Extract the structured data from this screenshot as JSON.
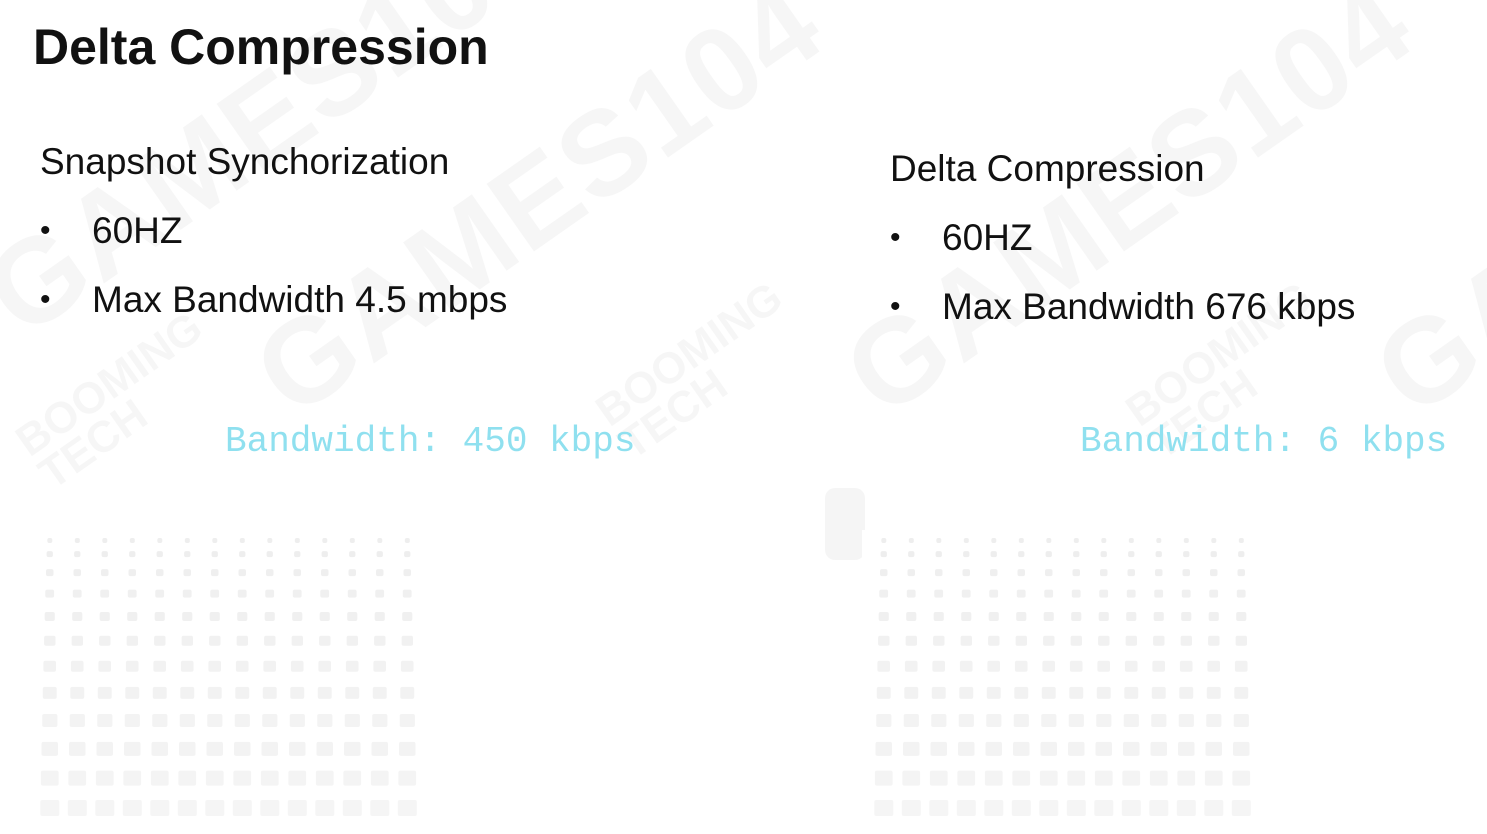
{
  "slide": {
    "title": "Delta Compression",
    "left_panel": {
      "heading": "Snapshot Synchorization",
      "bullets": [
        "60HZ",
        "Max Bandwidth 4.5 mbps"
      ],
      "bandwidth_readout": "Bandwidth: 450 kbps"
    },
    "right_panel": {
      "heading": "Delta Compression",
      "bullets": [
        "60HZ",
        "Max Bandwidth 676 kbps"
      ],
      "bandwidth_readout": "Bandwidth: 6 kbps"
    },
    "bullet_glyph": "•",
    "watermark": {
      "big_text": "GAMES104",
      "small_text_line1": "BOOMING",
      "small_text_line2": "TECH"
    }
  },
  "colors": {
    "readout": "#8fe0ef",
    "text": "#111111",
    "grid_block": "#ececec"
  }
}
